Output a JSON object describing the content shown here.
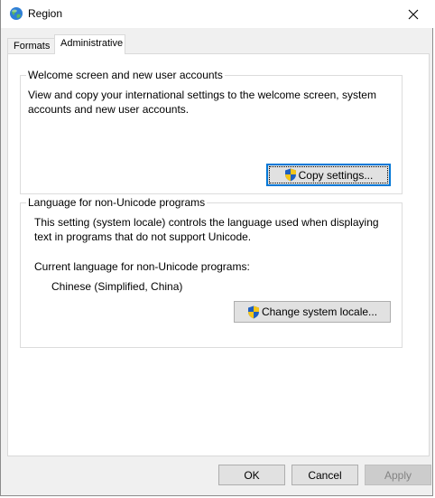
{
  "window": {
    "title": "Region",
    "close_glyph": "✕",
    "icon": "globe-icon"
  },
  "tabs": [
    {
      "label": "Formats",
      "active": false
    },
    {
      "label": "Administrative",
      "active": true
    }
  ],
  "welcome_group": {
    "title": "Welcome screen and new user accounts",
    "description_line1": "View and copy your international settings to the welcome screen, system",
    "description_line2": "accounts and new user accounts.",
    "copy_button": "Copy settings...",
    "copy_button_icon": "uac-shield-icon"
  },
  "locale_group": {
    "title": "Language for non-Unicode programs",
    "description_line1": "This setting (system locale) controls the language used when displaying",
    "description_line2": "text in programs that do not support Unicode.",
    "current_label": "Current language for non-Unicode programs:",
    "current_value": "Chinese (Simplified, China)",
    "change_button": "Change system locale...",
    "change_button_icon": "uac-shield-icon"
  },
  "footer": {
    "ok": "OK",
    "cancel": "Cancel",
    "apply": "Apply",
    "apply_enabled": false
  },
  "colors": {
    "focus_border": "#0078d7",
    "panel_bg": "#ffffff",
    "dialog_bg": "#f0f0f0"
  }
}
